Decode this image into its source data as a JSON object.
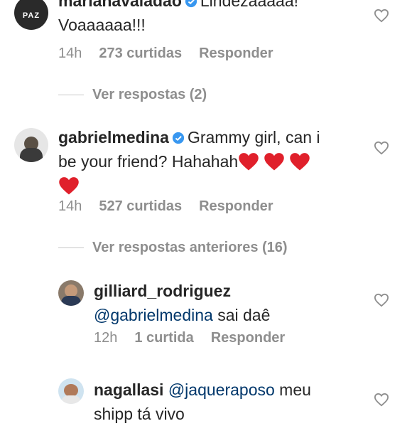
{
  "comments": [
    {
      "username": "marianavaladao",
      "text": "Lindezaaaaa! Voaaaaaa!!!",
      "text_line1": "Lindezaaaaa!",
      "text_line2": "Voaaaaaa!!!",
      "time": "14h",
      "likes": "273 curtidas",
      "reply": "Responder",
      "verified": true,
      "view_replies": "Ver respostas (2)"
    },
    {
      "username": "gabrielmedina",
      "text": "Grammy girl, can i be your friend? Hahahah",
      "text_line1": "Grammy girl, can i",
      "text_line2": "be your friend? Hahahah",
      "time": "14h",
      "likes": "527 curtidas",
      "reply": "Responder",
      "verified": true,
      "view_replies": "Ver respostas anteriores (16)"
    }
  ],
  "replies": [
    {
      "username": "gilliard_rodriguez",
      "mention": "@gabrielmedina",
      "text": "sai daê",
      "time": "12h",
      "likes": "1 curtida",
      "reply": "Responder"
    },
    {
      "username": "nagallasi",
      "mention": "@jaqueraposo",
      "text": "meu",
      "text_line2": "shipp tá vivo"
    }
  ],
  "colors": {
    "verified": "#3897f0",
    "heart_red": "#e0202b",
    "meta": "#8e8e8e",
    "mention": "#00376b"
  }
}
